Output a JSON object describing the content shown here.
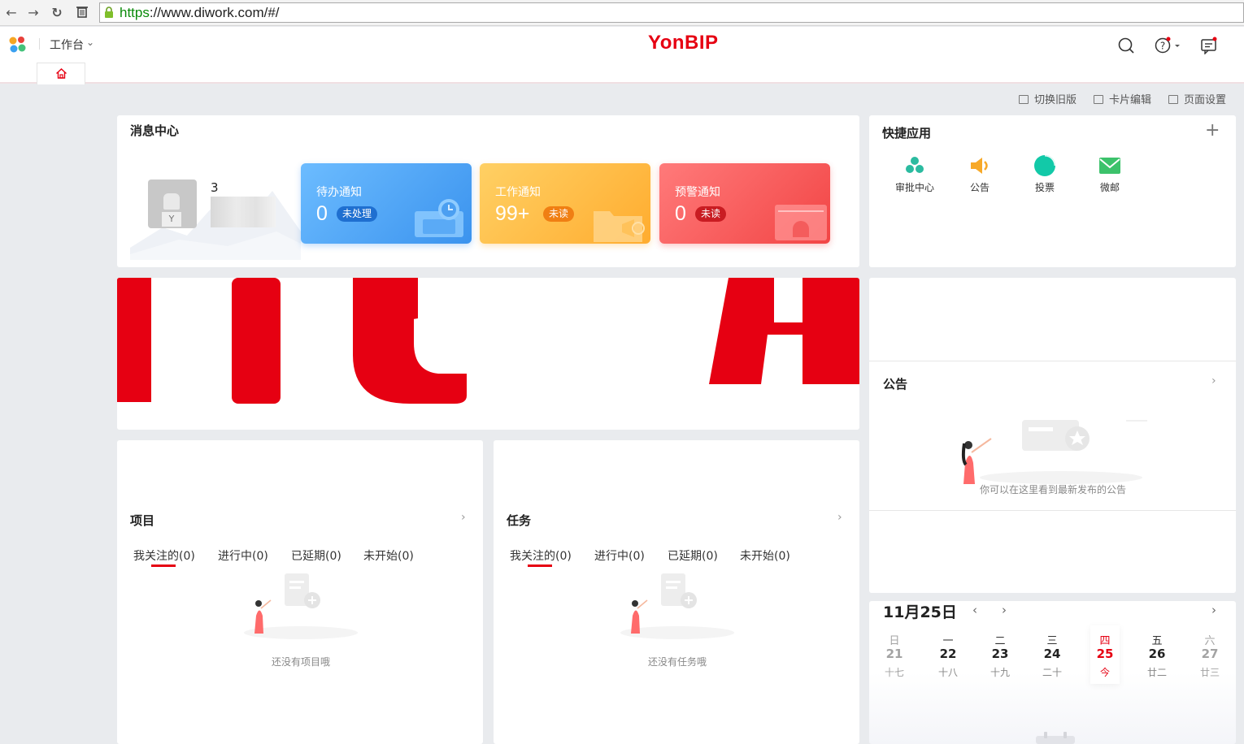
{
  "browser": {
    "url_scheme": "https",
    "url_rest": "://www.diwork.com/#/"
  },
  "header": {
    "workbench_label": "工作台",
    "brand": "YonBIP"
  },
  "toolbar": {
    "switch_old_label": "切换旧版",
    "card_edit_label": "卡片编辑",
    "page_settings_label": "页面设置"
  },
  "message_center": {
    "title": "消息中心",
    "user_count": "3",
    "notices": [
      {
        "label": "待办通知",
        "count": "0",
        "badge": "未处理",
        "color": "#4aa3f5"
      },
      {
        "label": "工作通知",
        "count": "99+",
        "badge": "未读",
        "color": "#ffb53f"
      },
      {
        "label": "预警通知",
        "count": "0",
        "badge": "未读",
        "color": "#f8545a"
      }
    ]
  },
  "quick_apps": {
    "title": "快捷应用",
    "items": [
      {
        "label": "审批中心",
        "icon": "approval-icon"
      },
      {
        "label": "公告",
        "icon": "speaker-icon"
      },
      {
        "label": "投票",
        "icon": "vote-pie-icon"
      },
      {
        "label": "微邮",
        "icon": "mail-icon"
      }
    ]
  },
  "announcement": {
    "title": "公告",
    "empty_text": "你可以在这里看到最新发布的公告"
  },
  "projects": {
    "title": "项目",
    "tabs": [
      "我关注的(0)",
      "进行中(0)",
      "已延期(0)",
      "未开始(0)"
    ],
    "empty_text": "还没有项目哦"
  },
  "tasks": {
    "title": "任务",
    "tabs": [
      "我关注的(0)",
      "进行中(0)",
      "已延期(0)",
      "未开始(0)"
    ],
    "empty_text": "还没有任务哦"
  },
  "calendar": {
    "date_label": "11月25日",
    "days": [
      {
        "weekday": "日",
        "day": "21",
        "lunar": "十七"
      },
      {
        "weekday": "一",
        "day": "22",
        "lunar": "十八"
      },
      {
        "weekday": "二",
        "day": "23",
        "lunar": "十九"
      },
      {
        "weekday": "三",
        "day": "24",
        "lunar": "二十"
      },
      {
        "weekday": "四",
        "day": "25",
        "lunar": "今"
      },
      {
        "weekday": "五",
        "day": "26",
        "lunar": "廿二"
      },
      {
        "weekday": "六",
        "day": "27",
        "lunar": "廿三"
      }
    ]
  },
  "colors": {
    "brand_red": "#e60012",
    "page_bg": "#e9ebee"
  }
}
